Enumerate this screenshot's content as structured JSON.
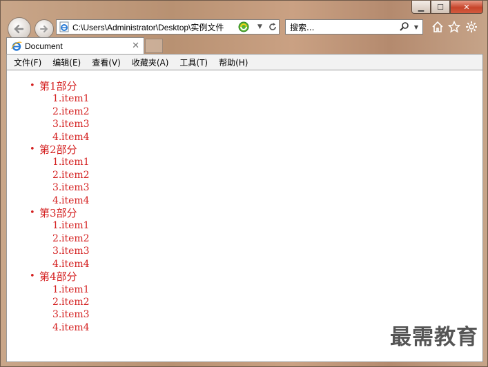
{
  "window": {
    "minimize": "▁",
    "maximize": "☐",
    "close": "✕"
  },
  "nav": {
    "back_icon": "arrow-left-icon",
    "forward_icon": "arrow-right-icon"
  },
  "address_bar": {
    "url": "C:\\Users\\Administrator\\Desktop\\实例文件"
  },
  "search_box": {
    "placeholder": "搜索..."
  },
  "tab": {
    "title": "Document"
  },
  "menu": [
    "文件(F)",
    "编辑(E)",
    "查看(V)",
    "收藏夹(A)",
    "工具(T)",
    "帮助(H)"
  ],
  "page": {
    "sections": [
      {
        "title": "第1部分",
        "items": [
          "item1",
          "item2",
          "item3",
          "item4"
        ]
      },
      {
        "title": "第2部分",
        "items": [
          "item1",
          "item2",
          "item3",
          "item4"
        ]
      },
      {
        "title": "第3部分",
        "items": [
          "item1",
          "item2",
          "item3",
          "item4"
        ]
      },
      {
        "title": "第4部分",
        "items": [
          "item1",
          "item2",
          "item3",
          "item4"
        ]
      }
    ],
    "text_color": "#d42020"
  },
  "watermark": "最需教育"
}
